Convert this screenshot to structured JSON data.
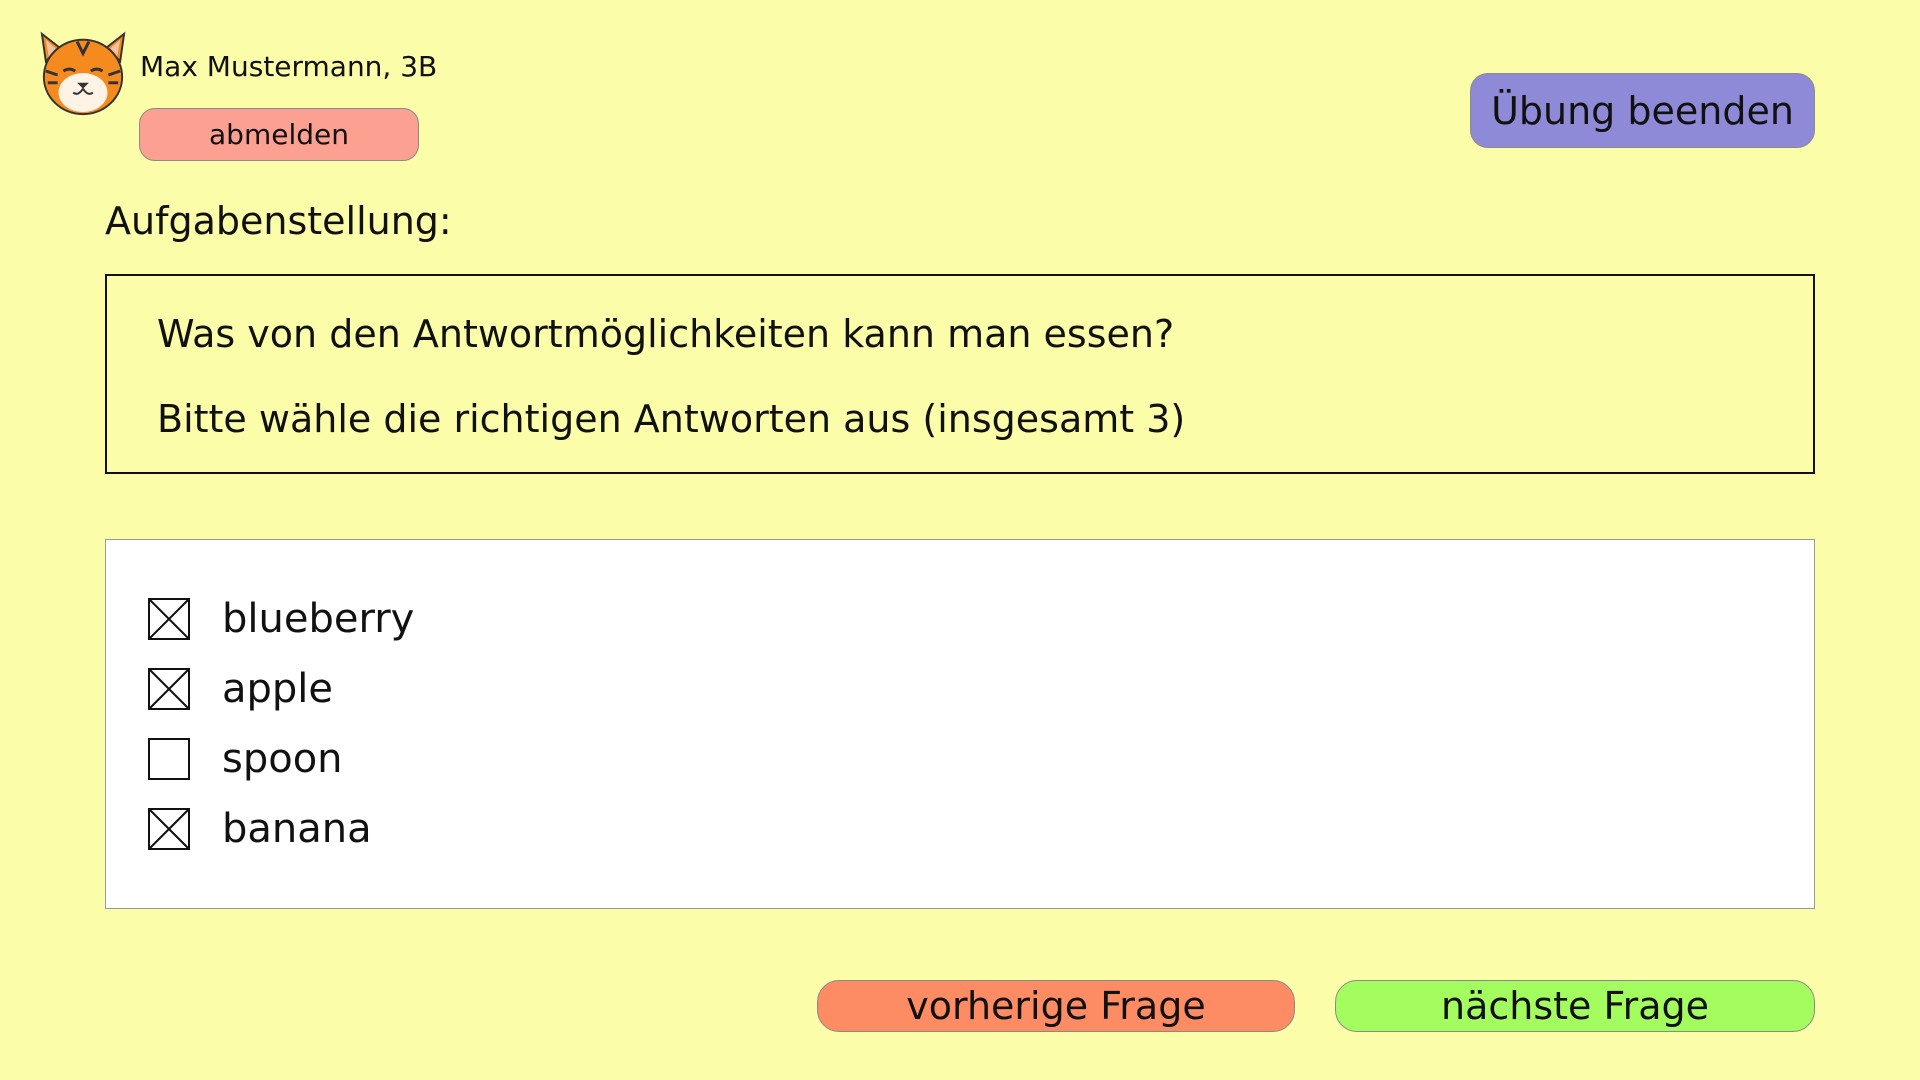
{
  "header": {
    "user_name": "Max Mustermann, 3B",
    "logout_label": "abmelden",
    "end_exercise_label": "Übung beenden",
    "avatar_icon": "tiger-avatar-icon"
  },
  "task": {
    "heading": "Aufgabenstellung:",
    "question": "Was von den Antwortmöglichkeiten kann man essen?",
    "instruction": "Bitte wähle die richtigen Antworten aus (insgesamt 3)"
  },
  "answers": [
    {
      "label": "blueberry",
      "checked": true
    },
    {
      "label": "apple",
      "checked": true
    },
    {
      "label": "spoon",
      "checked": false
    },
    {
      "label": "banana",
      "checked": true
    }
  ],
  "navigation": {
    "previous_label": "vorherige Frage",
    "next_label": "nächste Frage"
  },
  "colors": {
    "background": "#fbfda8",
    "logout_button": "#fca192",
    "end_button": "#8f8ad8",
    "previous_button": "#fd8b63",
    "next_button": "#a3fd5e"
  }
}
